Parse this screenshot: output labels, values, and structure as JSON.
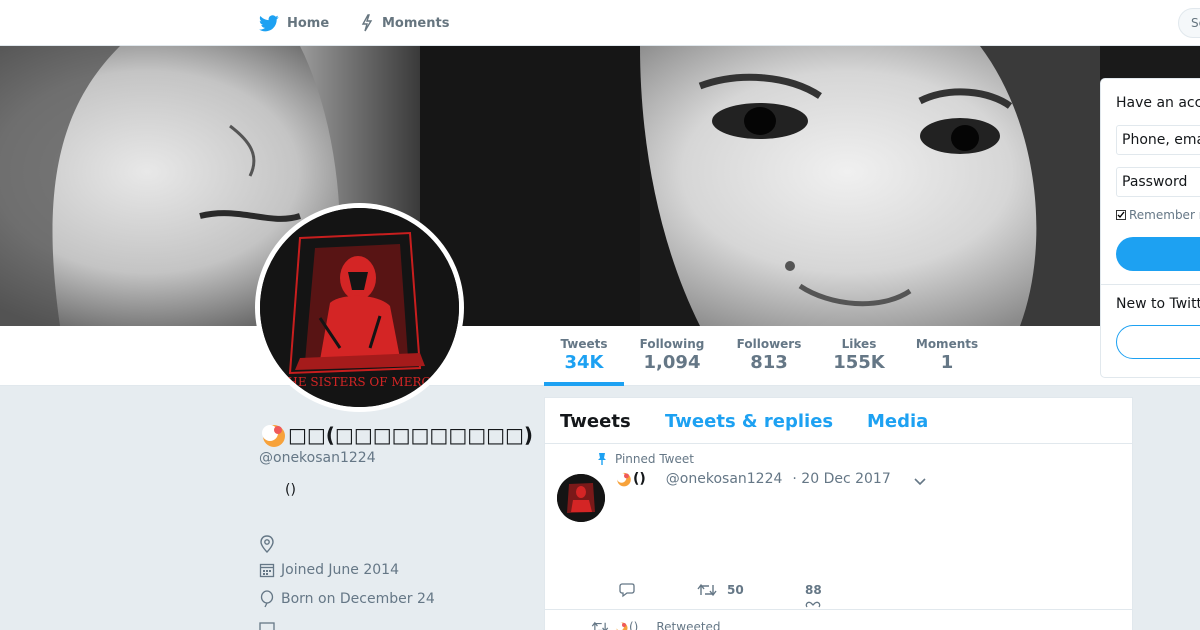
{
  "nav": {
    "home_label": "Home",
    "moments_label": "Moments",
    "search_stub": "Se",
    "tiny_link": "H"
  },
  "colors": {
    "brand": "#1da1f2",
    "text": "#14171a",
    "muted": "#657786",
    "page_bg": "#e6ecf0"
  },
  "stats": [
    {
      "label": "Tweets",
      "value": "34K"
    },
    {
      "label": "Following",
      "value": "1,094"
    },
    {
      "label": "Followers",
      "value": "813"
    },
    {
      "label": "Likes",
      "value": "155K"
    },
    {
      "label": "Moments",
      "value": "1"
    }
  ],
  "avatar": {
    "caption": "THE SISTERS OF MERCY"
  },
  "profile": {
    "name": "\u0000\u0000(\u0000\u0000\u0000\u0000\u0000\u0000\u0000\u0000\u0000\u0000)",
    "name_display": "□□(□□□□□□□□□□)",
    "handle": "@onekosan1224",
    "bio": "()",
    "joined": "Joined June 2014",
    "born": "Born on December 24",
    "emoji_icon": "orange-crescent-emoji"
  },
  "timeline": {
    "tabs": [
      "Tweets",
      "Tweets & replies",
      "Media"
    ],
    "pinned_label": "Pinned Tweet",
    "tweet": {
      "name": "()",
      "handle": "@onekosan1224",
      "date": "· 20 Dec 2017",
      "retweets": "50",
      "likes": "88"
    },
    "retweet_name": "()",
    "retweeted_label": "Retweeted"
  },
  "login": {
    "title": "Have an account?",
    "phone_placeholder": "Phone, email",
    "password_placeholder": "Password",
    "remember_label": "Remember me",
    "new_to": "New to Twitter?"
  }
}
